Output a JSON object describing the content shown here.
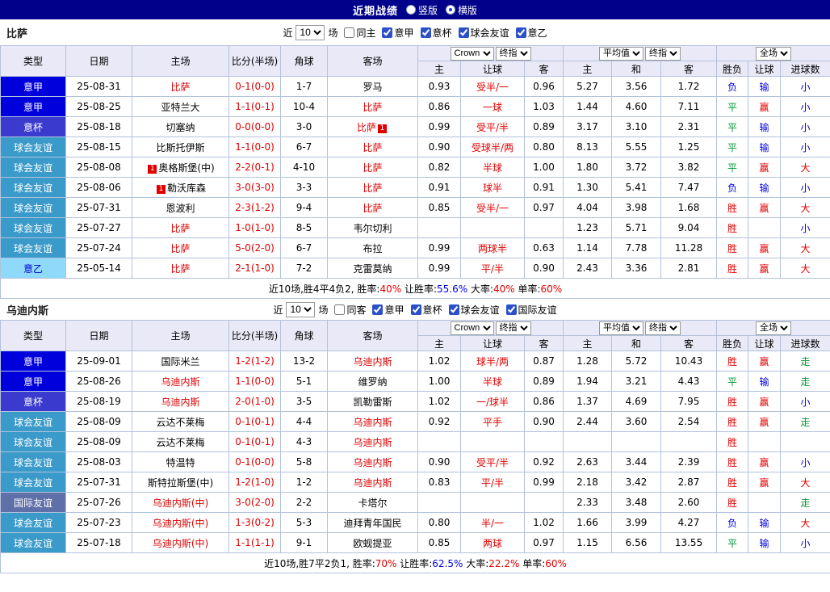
{
  "colors": {
    "topbar_bg": "#00008B",
    "header_bg": "#E9E9F7",
    "border": "#B2C2DC",
    "red": "#E00000",
    "blue": "#0000E0",
    "green": "#009933",
    "seriea_bg": "#0000DD",
    "cup_bg": "#3A3ACE",
    "friendly_bg": "#3A9BCB",
    "serieb_bg": "#8FD9FB",
    "serieb_text": "#0000CC",
    "intl_bg": "#5F6FA8"
  },
  "topbar": {
    "title": "近期战绩",
    "options": [
      {
        "label": "竖版",
        "selected": false
      },
      {
        "label": "横版",
        "selected": true
      }
    ]
  },
  "sections": [
    {
      "team": "比萨",
      "filter": {
        "prefix": "近",
        "count": "10",
        "suffix": "场",
        "checkboxes": [
          {
            "label": "同主",
            "checked": false
          },
          {
            "label": "意甲",
            "checked": true
          },
          {
            "label": "意杯",
            "checked": true
          },
          {
            "label": "球会友谊",
            "checked": true
          },
          {
            "label": "意乙",
            "checked": true
          }
        ]
      },
      "header": {
        "cols": [
          "类型",
          "日期",
          "主场",
          "比分(半场)",
          "角球",
          "客场"
        ],
        "odds_dropdowns": [
          "Crown",
          "终指"
        ],
        "avg_dropdowns": [
          "平均值",
          "终指"
        ],
        "result_dropdowns": [
          "全场"
        ],
        "sub_cols": [
          "主",
          "让球",
          "客",
          "主",
          "和",
          "客",
          "胜负",
          "让球",
          "进球数"
        ]
      },
      "rows": [
        [
          {
            "t": "意甲",
            "tc": "t-a"
          },
          "25-08-31",
          {
            "t": "比萨",
            "c": "red"
          },
          {
            "t": "0-1(0-0)",
            "c": "red"
          },
          "1-7",
          "罗马",
          "0.93",
          {
            "t": "受半/一",
            "c": "red"
          },
          "0.96",
          "5.27",
          "3.56",
          "1.72",
          {
            "t": "负",
            "c": "blue"
          },
          {
            "t": "输",
            "c": "blue"
          },
          {
            "t": "小",
            "c": "blue"
          }
        ],
        [
          {
            "t": "意甲",
            "tc": "t-a"
          },
          "25-08-25",
          "亚特兰大",
          {
            "t": "1-1(0-1)",
            "c": "red"
          },
          "10-4",
          {
            "t": "比萨",
            "c": "red"
          },
          "0.86",
          {
            "t": "一球",
            "c": "red"
          },
          "1.03",
          "1.44",
          "4.60",
          "7.11",
          {
            "t": "平",
            "c": "green"
          },
          {
            "t": "赢",
            "c": "red"
          },
          {
            "t": "小",
            "c": "blue"
          }
        ],
        [
          {
            "t": "意杯",
            "tc": "t-cup"
          },
          "25-08-18",
          "切塞纳",
          {
            "t": "0-0(0-0)",
            "c": "red"
          },
          "3-0",
          {
            "p": [
              {
                "t": "比萨",
                "c": "red"
              },
              {
                "t": "1",
                "c": "badge"
              }
            ]
          },
          "0.99",
          {
            "t": "受平/半",
            "c": "red"
          },
          "0.89",
          "3.17",
          "3.10",
          "2.31",
          {
            "t": "平",
            "c": "green"
          },
          {
            "t": "输",
            "c": "blue"
          },
          {
            "t": "小",
            "c": "blue"
          }
        ],
        [
          {
            "t": "球会友谊",
            "tc": "t-fr"
          },
          "25-08-15",
          "比斯托伊斯",
          {
            "t": "1-1(0-0)",
            "c": "red"
          },
          "6-7",
          {
            "t": "比萨",
            "c": "red"
          },
          "0.90",
          {
            "t": "受球半/两",
            "c": "red"
          },
          "0.80",
          "8.13",
          "5.55",
          "1.25",
          {
            "t": "平",
            "c": "green"
          },
          {
            "t": "输",
            "c": "blue"
          },
          {
            "t": "小",
            "c": "blue"
          }
        ],
        [
          {
            "t": "球会友谊",
            "tc": "t-fr"
          },
          "25-08-08",
          {
            "p": [
              {
                "t": "1",
                "c": "badge"
              },
              {
                "t": "奥格斯堡(中)"
              }
            ]
          },
          {
            "t": "2-2(0-1)",
            "c": "red"
          },
          "4-10",
          {
            "t": "比萨",
            "c": "red"
          },
          "0.82",
          {
            "t": "半球",
            "c": "red"
          },
          "1.00",
          "1.80",
          "3.72",
          "3.82",
          {
            "t": "平",
            "c": "green"
          },
          {
            "t": "赢",
            "c": "red"
          },
          {
            "t": "大",
            "c": "red"
          }
        ],
        [
          {
            "t": "球会友谊",
            "tc": "t-fr"
          },
          "25-08-06",
          {
            "p": [
              {
                "t": "1",
                "c": "badge"
              },
              {
                "t": "勒沃库森"
              }
            ]
          },
          {
            "t": "3-0(3-0)",
            "c": "red"
          },
          "3-3",
          {
            "t": "比萨",
            "c": "red"
          },
          "0.91",
          {
            "t": "球半",
            "c": "red"
          },
          "0.91",
          "1.30",
          "5.41",
          "7.47",
          {
            "t": "负",
            "c": "blue"
          },
          {
            "t": "输",
            "c": "blue"
          },
          {
            "t": "小",
            "c": "blue"
          }
        ],
        [
          {
            "t": "球会友谊",
            "tc": "t-fr"
          },
          "25-07-31",
          "恩波利",
          {
            "t": "2-3(1-2)",
            "c": "red"
          },
          "9-4",
          {
            "t": "比萨",
            "c": "red"
          },
          "0.85",
          {
            "t": "受半/一",
            "c": "red"
          },
          "0.97",
          "4.04",
          "3.98",
          "1.68",
          {
            "t": "胜",
            "c": "red"
          },
          {
            "t": "赢",
            "c": "red"
          },
          {
            "t": "大",
            "c": "red"
          }
        ],
        [
          {
            "t": "球会友谊",
            "tc": "t-fr"
          },
          "25-07-27",
          {
            "t": "比萨",
            "c": "red"
          },
          {
            "t": "1-0(1-0)",
            "c": "red"
          },
          "8-5",
          "韦尔切利",
          "",
          "",
          "",
          "1.23",
          "5.71",
          "9.04",
          {
            "t": "胜",
            "c": "red"
          },
          "",
          {
            "t": "小",
            "c": "blue"
          }
        ],
        [
          {
            "t": "球会友谊",
            "tc": "t-fr"
          },
          "25-07-24",
          {
            "t": "比萨",
            "c": "red"
          },
          {
            "t": "5-0(2-0)",
            "c": "red"
          },
          "6-7",
          "布拉",
          "0.99",
          {
            "t": "两球半",
            "c": "red"
          },
          "0.63",
          "1.14",
          "7.78",
          "11.28",
          {
            "t": "胜",
            "c": "red"
          },
          {
            "t": "赢",
            "c": "red"
          },
          {
            "t": "大",
            "c": "red"
          }
        ],
        [
          {
            "t": "意乙",
            "tc": "t-b"
          },
          "25-05-14",
          {
            "t": "比萨",
            "c": "red"
          },
          {
            "t": "2-1(1-0)",
            "c": "red"
          },
          "7-2",
          "克雷莫纳",
          "0.99",
          {
            "t": "平/半",
            "c": "red"
          },
          "0.90",
          "2.43",
          "3.36",
          "2.81",
          {
            "t": "胜",
            "c": "red"
          },
          {
            "t": "赢",
            "c": "red"
          },
          {
            "t": "大",
            "c": "red"
          }
        ]
      ],
      "summary": [
        {
          "t": "近10场,胜4平4负2, 胜率:"
        },
        {
          "t": "40%",
          "c": "red"
        },
        {
          "t": " 让胜率:"
        },
        {
          "t": "55.6%",
          "c": "blue"
        },
        {
          "t": " 大率:"
        },
        {
          "t": "40%",
          "c": "red"
        },
        {
          "t": " 单率:"
        },
        {
          "t": "60%",
          "c": "red"
        }
      ]
    },
    {
      "team": "乌迪内斯",
      "filter": {
        "prefix": "近",
        "count": "10",
        "suffix": "场",
        "checkboxes": [
          {
            "label": "同客",
            "checked": false
          },
          {
            "label": "意甲",
            "checked": true
          },
          {
            "label": "意杯",
            "checked": true
          },
          {
            "label": "球会友谊",
            "checked": true
          },
          {
            "label": "国际友谊",
            "checked": true
          }
        ]
      },
      "header": {
        "cols": [
          "类型",
          "日期",
          "主场",
          "比分(半场)",
          "角球",
          "客场"
        ],
        "odds_dropdowns": [
          "Crown",
          "终指"
        ],
        "avg_dropdowns": [
          "平均值",
          "终指"
        ],
        "result_dropdowns": [
          "全场"
        ],
        "sub_cols": [
          "主",
          "让球",
          "客",
          "主",
          "和",
          "客",
          "胜负",
          "让球",
          "进球数"
        ]
      },
      "rows": [
        [
          {
            "t": "意甲",
            "tc": "t-a"
          },
          "25-09-01",
          "国际米兰",
          {
            "t": "1-2(1-2)",
            "c": "red"
          },
          "13-2",
          {
            "t": "乌迪内斯",
            "c": "red"
          },
          "1.02",
          {
            "t": "球半/两",
            "c": "red"
          },
          "0.87",
          "1.28",
          "5.72",
          "10.43",
          {
            "t": "胜",
            "c": "red"
          },
          {
            "t": "赢",
            "c": "red"
          },
          {
            "t": "走",
            "c": "green"
          }
        ],
        [
          {
            "t": "意甲",
            "tc": "t-a"
          },
          "25-08-26",
          {
            "t": "乌迪内斯",
            "c": "red"
          },
          {
            "t": "1-1(0-0)",
            "c": "red"
          },
          "5-1",
          "维罗纳",
          "1.00",
          {
            "t": "半球",
            "c": "red"
          },
          "0.89",
          "1.94",
          "3.21",
          "4.43",
          {
            "t": "平",
            "c": "green"
          },
          {
            "t": "输",
            "c": "blue"
          },
          {
            "t": "走",
            "c": "green"
          }
        ],
        [
          {
            "t": "意杯",
            "tc": "t-cup"
          },
          "25-08-19",
          {
            "t": "乌迪内斯",
            "c": "red"
          },
          {
            "t": "2-0(1-0)",
            "c": "red"
          },
          "3-5",
          "凯勒雷斯",
          "1.02",
          {
            "t": "一/球半",
            "c": "red"
          },
          "0.86",
          "1.37",
          "4.69",
          "7.95",
          {
            "t": "胜",
            "c": "red"
          },
          {
            "t": "赢",
            "c": "red"
          },
          {
            "t": "小",
            "c": "blue"
          }
        ],
        [
          {
            "t": "球会友谊",
            "tc": "t-fr"
          },
          "25-08-09",
          "云达不莱梅",
          {
            "t": "0-1(0-1)",
            "c": "red"
          },
          "4-4",
          {
            "t": "乌迪内斯",
            "c": "red"
          },
          "0.92",
          {
            "t": "平手",
            "c": "red"
          },
          "0.90",
          "2.44",
          "3.60",
          "2.54",
          {
            "t": "胜",
            "c": "red"
          },
          {
            "t": "赢",
            "c": "red"
          },
          {
            "t": "走",
            "c": "green"
          }
        ],
        [
          {
            "t": "球会友谊",
            "tc": "t-fr"
          },
          "25-08-09",
          "云达不莱梅",
          {
            "t": "0-1(0-1)",
            "c": "red"
          },
          "4-3",
          {
            "t": "乌迪内斯",
            "c": "red"
          },
          "",
          "",
          "",
          "",
          "",
          "",
          {
            "t": "胜",
            "c": "red"
          },
          "",
          ""
        ],
        [
          {
            "t": "球会友谊",
            "tc": "t-fr"
          },
          "25-08-03",
          "特温特",
          {
            "t": "0-1(0-0)",
            "c": "red"
          },
          "5-8",
          {
            "t": "乌迪内斯",
            "c": "red"
          },
          "0.90",
          {
            "t": "受平/半",
            "c": "red"
          },
          "0.92",
          "2.63",
          "3.44",
          "2.39",
          {
            "t": "胜",
            "c": "red"
          },
          {
            "t": "赢",
            "c": "red"
          },
          {
            "t": "小",
            "c": "blue"
          }
        ],
        [
          {
            "t": "球会友谊",
            "tc": "t-fr"
          },
          "25-07-31",
          "斯特拉斯堡(中)",
          {
            "t": "1-2(1-0)",
            "c": "red"
          },
          "1-2",
          {
            "t": "乌迪内斯",
            "c": "red"
          },
          "0.83",
          {
            "t": "平/半",
            "c": "red"
          },
          "0.99",
          "2.18",
          "3.42",
          "2.87",
          {
            "t": "胜",
            "c": "red"
          },
          {
            "t": "赢",
            "c": "red"
          },
          {
            "t": "大",
            "c": "red"
          }
        ],
        [
          {
            "t": "国际友谊",
            "tc": "t-intl"
          },
          "25-07-26",
          {
            "t": "乌迪内斯(中)",
            "c": "red"
          },
          {
            "t": "3-0(2-0)",
            "c": "red"
          },
          "2-2",
          "卡塔尔",
          "",
          "",
          "",
          "2.33",
          "3.48",
          "2.60",
          {
            "t": "胜",
            "c": "red"
          },
          "",
          {
            "t": "走",
            "c": "green"
          }
        ],
        [
          {
            "t": "球会友谊",
            "tc": "t-fr"
          },
          "25-07-23",
          {
            "t": "乌迪内斯(中)",
            "c": "red"
          },
          {
            "t": "1-3(0-2)",
            "c": "red"
          },
          "5-3",
          "迪拜青年国民",
          "0.80",
          {
            "t": "半/一",
            "c": "red"
          },
          "1.02",
          "1.66",
          "3.99",
          "4.27",
          {
            "t": "负",
            "c": "blue"
          },
          {
            "t": "输",
            "c": "blue"
          },
          {
            "t": "大",
            "c": "red"
          }
        ],
        [
          {
            "t": "球会友谊",
            "tc": "t-fr"
          },
          "25-07-18",
          {
            "t": "乌迪内斯(中)",
            "c": "red"
          },
          {
            "t": "1-1(1-1)",
            "c": "red"
          },
          "9-1",
          "欧蚬提亚",
          "0.85",
          {
            "t": "两球",
            "c": "red"
          },
          "0.97",
          "1.15",
          "6.56",
          "13.55",
          {
            "t": "平",
            "c": "green"
          },
          {
            "t": "输",
            "c": "blue"
          },
          {
            "t": "小",
            "c": "blue"
          }
        ]
      ],
      "summary": [
        {
          "t": "近10场,胜7平2负1, 胜率:"
        },
        {
          "t": "70%",
          "c": "red"
        },
        {
          "t": " 让胜率:"
        },
        {
          "t": "62.5%",
          "c": "blue"
        },
        {
          "t": " 大率:"
        },
        {
          "t": "22.2%",
          "c": "red"
        },
        {
          "t": " 单率:"
        },
        {
          "t": "60%",
          "c": "red"
        }
      ]
    }
  ]
}
